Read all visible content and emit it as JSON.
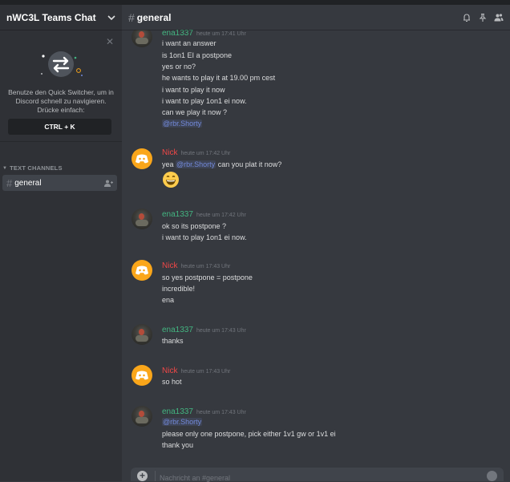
{
  "server": {
    "name": "nWC3L Teams Chat"
  },
  "quick_switcher": {
    "text": "Benutze den Quick Switcher, um in Discord schnell zu navigieren. Drücke einfach:",
    "shortcut": "CTRL + K"
  },
  "sidebar": {
    "category": "TEXT CHANNELS",
    "channels": [
      {
        "name": "general",
        "selected": true
      }
    ]
  },
  "header": {
    "channel": "general"
  },
  "colors": {
    "ena": "#43b581",
    "nick": "#f04747",
    "mention": "#7289da",
    "avatar_nick": "#faa61a"
  },
  "messages": [
    {
      "author": "ena1337",
      "time": "heute um 17:41 Uhr",
      "lines": [
        "i want an answer",
        "is 1on1 EI a postpone",
        "yes or no?",
        "he wants to play it at 19.00 pm cest",
        "i want to play it now",
        "i want to play 1on1 ei now.",
        "can we play it now ?"
      ],
      "mention": "@rbr.Shorty"
    },
    {
      "author": "Nick",
      "time": "heute um 17:42 Uhr",
      "prefix": "yea",
      "mention": "@rbr.Shorty",
      "suffix": "can you plat it now?",
      "emoji": "grinning-emoji"
    },
    {
      "author": "ena1337",
      "time": "heute um 17:42 Uhr",
      "lines": [
        "ok so its postpone ?",
        "i want to play 1on1 ei now."
      ]
    },
    {
      "author": "Nick",
      "time": "heute um 17:43 Uhr",
      "lines": [
        "so yes postpone = postpone",
        "incredible!",
        "ena"
      ]
    },
    {
      "author": "ena1337",
      "time": "heute um 17:43 Uhr",
      "lines": [
        "thanks"
      ]
    },
    {
      "author": "Nick",
      "time": "heute um 17:43 Uhr",
      "lines": [
        "so hot"
      ]
    },
    {
      "author": "ena1337",
      "time": "heute um 17:43 Uhr",
      "mention": "@rbr.Shorty",
      "lines": [
        "please only one postpone, pick either 1v1 gw or 1v1 ei",
        "thank you"
      ]
    }
  ],
  "composer": {
    "placeholder": "Nachricht an #general"
  }
}
